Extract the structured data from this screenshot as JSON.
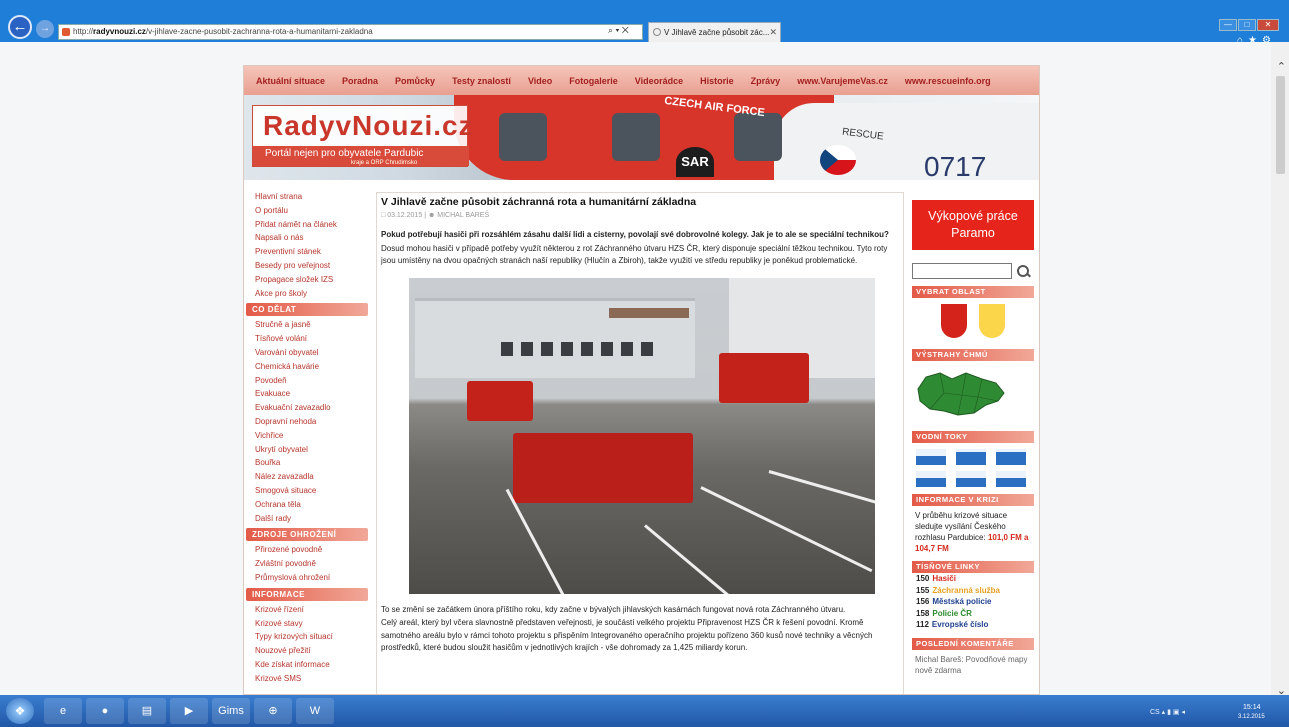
{
  "browser": {
    "address": "http://www.radyvnouzi.cz/v-jihlave-zacne-pusobit-zachranna-rota-a-humanitarni-zakladna",
    "address_prefix": "http://",
    "address_domain": "radyvnouzi.cz",
    "address_path": "/v-jihlave-zacne-pusobit-zachranna-rota-a-humanitarni-zakladna",
    "tab_title": "V Jihlavě začne působit zác...",
    "address_tools": "⌕ ▾ ✕"
  },
  "topnav": [
    "Aktuální situace",
    "Poradna",
    "Pomůcky",
    "Testy znalostí",
    "Video",
    "Fotogalerie",
    "Videorádce",
    "Historie",
    "Zprávy",
    "www.VarujemeVas.cz",
    "www.rescueinfo.org"
  ],
  "banner": {
    "logo_title": "RadyvNouzi.cz",
    "logo_subtitle": "Portál nejen pro obyvatele Pardubic",
    "logo_sub2": "kraje a ORP Chrudimsko",
    "text_airforce": "CZECH AIR FORCE",
    "text_rescue": "RESCUE",
    "text_tail": "0717",
    "sar": "SAR"
  },
  "leftnav": {
    "main": [
      "Hlavní strana",
      "O portálu",
      "Přidat námět na článek",
      "Napsali o nás",
      "Preventivní stánek",
      "Besedy pro veřejnost",
      "Propagace složek IZS",
      "Akce pro školy"
    ],
    "co_delat_title": "CO DĚLAT",
    "co_delat": [
      "Stručně a jasně",
      "Tísňové volání",
      "Varování obyvatel",
      "Chemická havárie",
      "Povodeň",
      "Evakuace",
      "Evakuační zavazadlo",
      "Dopravní nehoda",
      "Vichřice",
      "Ukrytí obyvatel",
      "Bouřka",
      "Nález zavazadla",
      "Smogová situace",
      "Ochrana těla",
      "Další rady"
    ],
    "zdroje_title": "ZDROJE OHROŽENÍ",
    "zdroje": [
      "Přirozené povodně",
      "Zvláštní povodně",
      "Průmyslová ohrožení"
    ],
    "informace_title": "INFORMACE",
    "informace": [
      "Krizové řízení",
      "Krizové stavy",
      "Typy krizových situací",
      "Nouzové přežití",
      "Kde získat informace",
      "Krizové SMS"
    ]
  },
  "article": {
    "title": "V Jihlavě začne působit záchranná rota a humanitární základna",
    "date": "03.12.2015",
    "author": "MICHAL BAREŠ",
    "lead": "Pokud potřebují hasiči při rozsáhlém zásahu další lidi a cisterny, povolají své dobrovolné kolegy. Jak je to ale se speciální technikou?",
    "p1": "Dosud mohou hasiči v případě potřeby využít některou z rot Záchranného útvaru HZS ČR, který disponuje speciální těžkou technikou. Tyto roty jsou umístěny na dvou opačných stranách naší republiky (Hlučín a Zbiroh), takže využití ve středu republiky je poněkud problematické.",
    "p2": "To se změní se začátkem února příštího roku, kdy začne v bývalých jihlavských kasárnách fungovat nová rota Záchranného útvaru.",
    "p3": "Celý areál, který byl včera slavnostně představen veřejnosti, je součástí velkého projektu Připravenost HZS ČR k řešení povodní. Kromě samotného areálu bylo v rámci tohoto projektu s přispěním Integrovaného operačního projektu pořízeno 360 kusů nové techniky a věcných prostředků, které budou sloužit hasičům v jednotlivých krajích - vše dohromady za 1,425 miliardy korun."
  },
  "right": {
    "promo": "Výkopové práce Paramo",
    "vybrat_oblast": "VYBRAT OBLAST",
    "vystrahy": "VÝSTRAHY ČHMÚ",
    "vodni_toky": "VODNÍ TOKY",
    "informace_krize": "INFORMACE V KRIZI",
    "info_text": "V průběhu krizové situace sledujte vysílání Českého rozhlasu Pardubice:",
    "info_freq": "101,0 FM a 104,7 FM",
    "tisnove": "TÍSŇOVÉ LINKY",
    "lines": [
      {
        "num": "150",
        "name": "Hasiči",
        "color": "#d32a1e"
      },
      {
        "num": "155",
        "name": "Záchranná služba",
        "color": "#e8a020"
      },
      {
        "num": "156",
        "name": "Městská policie",
        "color": "#1f3f8f"
      },
      {
        "num": "158",
        "name": "Policie ČR",
        "color": "#2a8a2a"
      },
      {
        "num": "112",
        "name": "Evropské číslo",
        "color": "#1f3f8f"
      }
    ],
    "posledni": "POSLEDNÍ KOMENTÁŘE",
    "comment": "Michal Bareš: Povodňové mapy nově zdarma"
  },
  "taskbar": {
    "apps": [
      "e",
      "●",
      "▤",
      "▶",
      "Gims",
      "⊕",
      "W"
    ],
    "tray": "CS  ▴  ▮  ▣  ◂",
    "time": "15:14",
    "date": "3.12.2015"
  }
}
